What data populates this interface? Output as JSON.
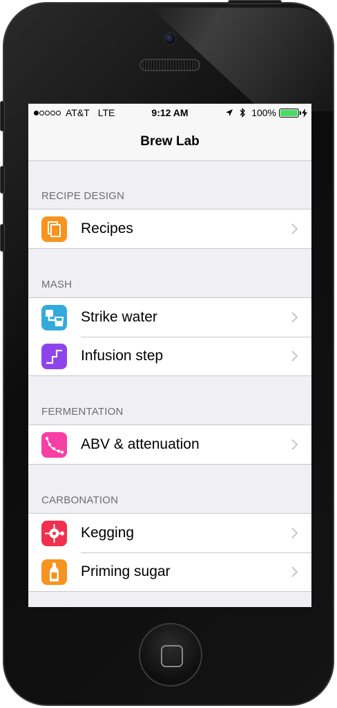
{
  "status_bar": {
    "carrier": "AT&T",
    "network": "LTE",
    "time": "9:12 AM",
    "battery": "100%",
    "battery_level": 1.0,
    "signal_bars_filled": 1,
    "signal_bars_total": 5,
    "icons": [
      "location-arrow-icon",
      "bluetooth-icon",
      "battery-icon",
      "charging-bolt-icon"
    ]
  },
  "nav": {
    "title": "Brew Lab"
  },
  "sections": [
    {
      "header": "RECIPE DESIGN",
      "items": [
        {
          "label": "Recipes",
          "icon": "recipes-icon",
          "color": "#f7931e"
        }
      ]
    },
    {
      "header": "MASH",
      "items": [
        {
          "label": "Strike water",
          "icon": "strike-water-icon",
          "color": "#34aadc"
        },
        {
          "label": "Infusion step",
          "icon": "infusion-step-icon",
          "color": "#8e44ec"
        }
      ]
    },
    {
      "header": "FERMENTATION",
      "items": [
        {
          "label": "ABV & attenuation",
          "icon": "abv-graph-icon",
          "color": "#f63ea4"
        }
      ]
    },
    {
      "header": "CARBONATION",
      "items": [
        {
          "label": "Kegging",
          "icon": "kegging-icon",
          "color": "#f2304e"
        },
        {
          "label": "Priming sugar",
          "icon": "bottle-icon",
          "color": "#f7931e"
        }
      ]
    }
  ],
  "colors": {
    "background": "#efeff4",
    "separator": "#c8c7cc",
    "section_header": "#6d6d72",
    "chevron": "#c7c7cc",
    "battery_fill": "#4cd964"
  }
}
